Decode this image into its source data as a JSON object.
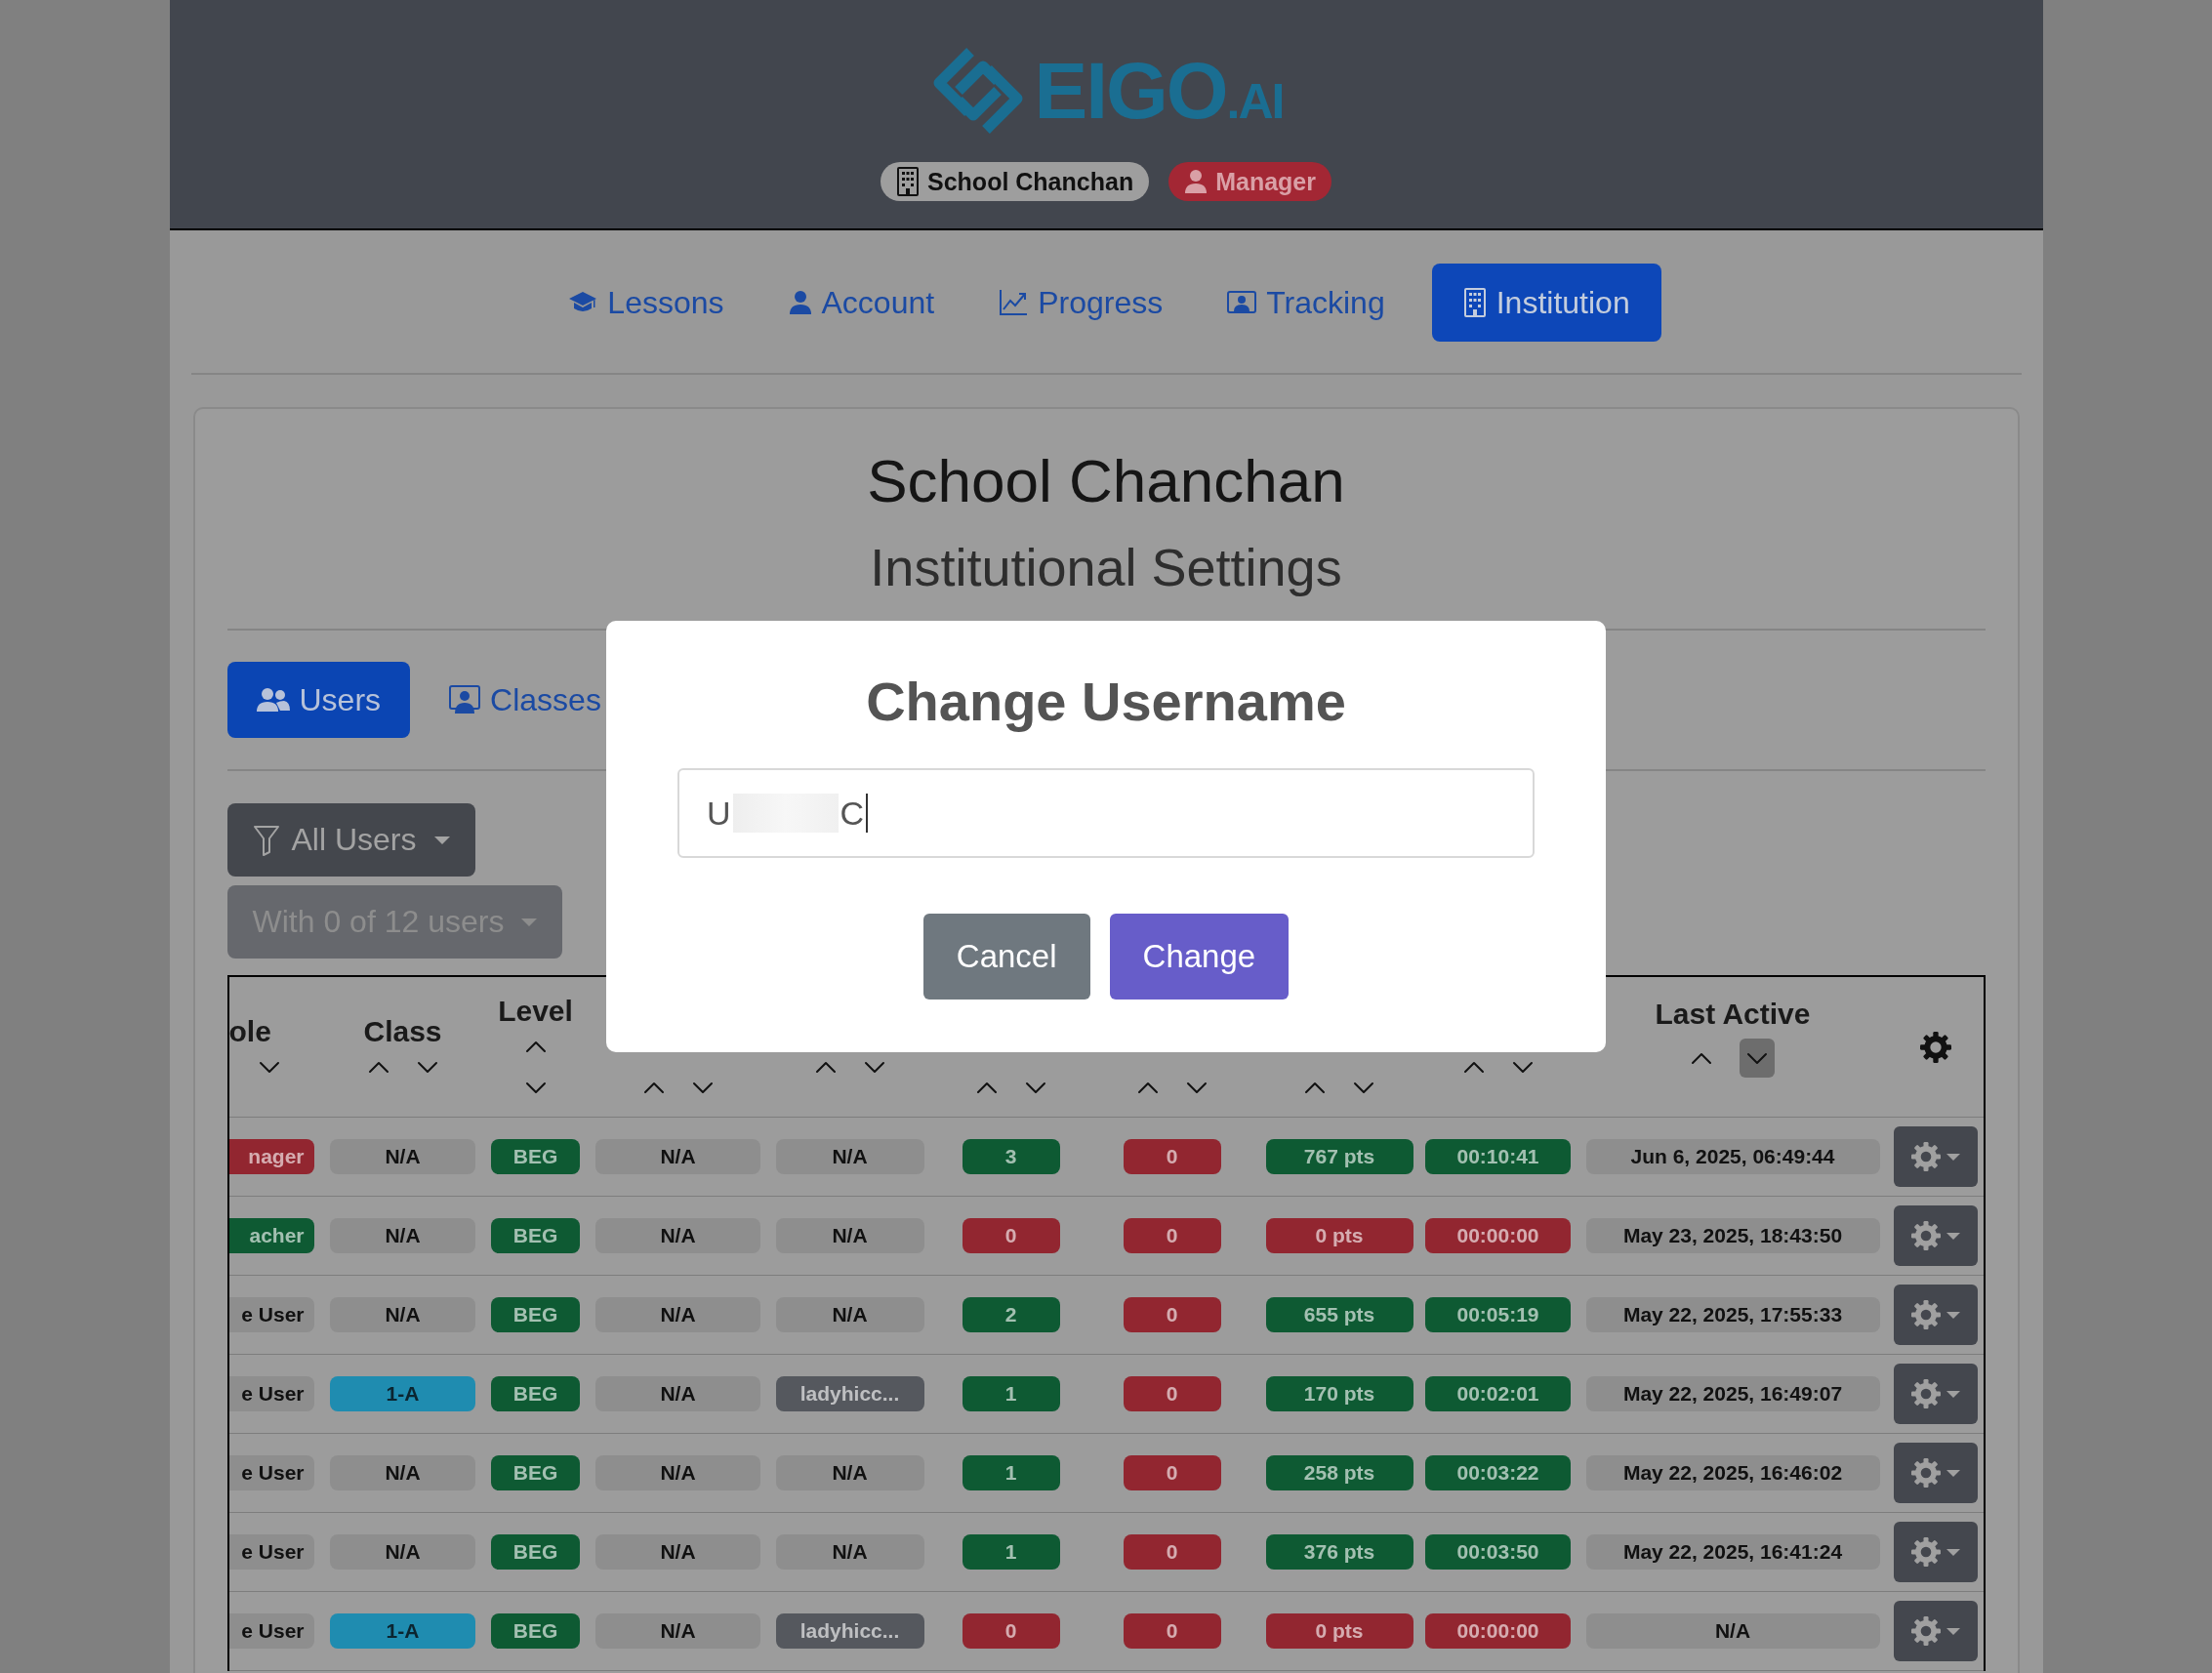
{
  "header": {
    "logo": {
      "text": "EIGO",
      "suffix": ".AI"
    },
    "badges": [
      {
        "kind": "institution",
        "label": "School Chanchan"
      },
      {
        "kind": "role",
        "label": "Manager"
      }
    ]
  },
  "nav": [
    {
      "kind": "cap",
      "label": "Lessons",
      "selected": false
    },
    {
      "kind": "person",
      "label": "Account",
      "selected": false
    },
    {
      "kind": "chart",
      "label": "Progress",
      "selected": false
    },
    {
      "kind": "frame",
      "label": "Tracking",
      "selected": false
    },
    {
      "kind": "building",
      "label": "Institution",
      "selected": true
    }
  ],
  "institution": {
    "title": "School Chanchan",
    "subtitle": "Institutional Settings"
  },
  "tabs": [
    {
      "kind": "users",
      "label": "Users",
      "selected": true
    },
    {
      "kind": "classes",
      "label": "Classes",
      "selected": false
    }
  ],
  "filters": [
    {
      "kind": "filter",
      "label": "All Users",
      "disabled": false
    },
    {
      "kind": "plain",
      "label": "With 0 of 12 users",
      "disabled": true
    }
  ],
  "table": {
    "columns": [
      {
        "kind": "row",
        "label": "ole",
        "sorted_desc": false
      },
      {
        "kind": "row",
        "label": "Class",
        "up_arrow": true,
        "sorted_desc": false
      },
      {
        "kind": "stacked",
        "label": "Level",
        "up_arrow": true,
        "sorted_desc": false
      },
      {
        "kind": "low",
        "up_arrow": true,
        "sorted_desc": false
      },
      {
        "kind": "row",
        "up_arrow": true,
        "sorted_desc": false
      },
      {
        "kind": "low",
        "up_arrow": true,
        "sorted_desc": false
      },
      {
        "kind": "low",
        "up_arrow": true,
        "sorted_desc": false
      },
      {
        "kind": "low",
        "up_arrow": true,
        "sorted_desc": false
      },
      {
        "kind": "row",
        "up_arrow": true,
        "sorted_desc": false
      },
      {
        "kind": "row",
        "label": "Last Active",
        "up_arrow": true,
        "sorted_desc": true
      },
      {
        "kind": "settings"
      }
    ],
    "rows": [
      {
        "cells": [
          {
            "text": "nager",
            "color": "#922630"
          },
          {
            "text": "N/A",
            "color": "#8e8e8e"
          },
          {
            "text": "BEG",
            "color": "#0e5a33"
          },
          {
            "text": "N/A",
            "color": "#8e8e8e"
          },
          {
            "text": "N/A",
            "color": "#8e8e8e"
          },
          {
            "text": "3",
            "color": "#0e5a33"
          },
          {
            "text": "0",
            "color": "#922630"
          },
          {
            "text": "767 pts",
            "color": "#0e5a33"
          },
          {
            "text": "00:10:41",
            "color": "#0e5a33"
          },
          {
            "text": "Jun 6, 2025, 06:49:44",
            "color": "#8e8e8e"
          }
        ]
      },
      {
        "cells": [
          {
            "text": "acher",
            "color": "#0e5a33"
          },
          {
            "text": "N/A",
            "color": "#8e8e8e"
          },
          {
            "text": "BEG",
            "color": "#0e5a33"
          },
          {
            "text": "N/A",
            "color": "#8e8e8e"
          },
          {
            "text": "N/A",
            "color": "#8e8e8e"
          },
          {
            "text": "0",
            "color": "#922630"
          },
          {
            "text": "0",
            "color": "#922630"
          },
          {
            "text": "0 pts",
            "color": "#922630"
          },
          {
            "text": "00:00:00",
            "color": "#922630"
          },
          {
            "text": "May 23, 2025, 18:43:50",
            "color": "#8e8e8e"
          }
        ]
      },
      {
        "cells": [
          {
            "text": "e User",
            "color": "#8e8e8e"
          },
          {
            "text": "N/A",
            "color": "#8e8e8e"
          },
          {
            "text": "BEG",
            "color": "#0e5a33"
          },
          {
            "text": "N/A",
            "color": "#8e8e8e"
          },
          {
            "text": "N/A",
            "color": "#8e8e8e"
          },
          {
            "text": "2",
            "color": "#0e5a33"
          },
          {
            "text": "0",
            "color": "#922630"
          },
          {
            "text": "655 pts",
            "color": "#0e5a33"
          },
          {
            "text": "00:05:19",
            "color": "#0e5a33"
          },
          {
            "text": "May 22, 2025, 17:55:33",
            "color": "#8e8e8e"
          }
        ]
      },
      {
        "cells": [
          {
            "text": "e User",
            "color": "#8e8e8e"
          },
          {
            "text": "1-A",
            "color": "#1f8cb0"
          },
          {
            "text": "BEG",
            "color": "#0e5a33"
          },
          {
            "text": "N/A",
            "color": "#8e8e8e"
          },
          {
            "text": "ladyhicc...",
            "color": "#55585e"
          },
          {
            "text": "1",
            "color": "#0e5a33"
          },
          {
            "text": "0",
            "color": "#922630"
          },
          {
            "text": "170 pts",
            "color": "#0e5a33"
          },
          {
            "text": "00:02:01",
            "color": "#0e5a33"
          },
          {
            "text": "May 22, 2025, 16:49:07",
            "color": "#8e8e8e"
          }
        ]
      },
      {
        "cells": [
          {
            "text": "e User",
            "color": "#8e8e8e"
          },
          {
            "text": "N/A",
            "color": "#8e8e8e"
          },
          {
            "text": "BEG",
            "color": "#0e5a33"
          },
          {
            "text": "N/A",
            "color": "#8e8e8e"
          },
          {
            "text": "N/A",
            "color": "#8e8e8e"
          },
          {
            "text": "1",
            "color": "#0e5a33"
          },
          {
            "text": "0",
            "color": "#922630"
          },
          {
            "text": "258 pts",
            "color": "#0e5a33"
          },
          {
            "text": "00:03:22",
            "color": "#0e5a33"
          },
          {
            "text": "May 22, 2025, 16:46:02",
            "color": "#8e8e8e"
          }
        ]
      },
      {
        "cells": [
          {
            "text": "e User",
            "color": "#8e8e8e"
          },
          {
            "text": "N/A",
            "color": "#8e8e8e"
          },
          {
            "text": "BEG",
            "color": "#0e5a33"
          },
          {
            "text": "N/A",
            "color": "#8e8e8e"
          },
          {
            "text": "N/A",
            "color": "#8e8e8e"
          },
          {
            "text": "1",
            "color": "#0e5a33"
          },
          {
            "text": "0",
            "color": "#922630"
          },
          {
            "text": "376 pts",
            "color": "#0e5a33"
          },
          {
            "text": "00:03:50",
            "color": "#0e5a33"
          },
          {
            "text": "May 22, 2025, 16:41:24",
            "color": "#8e8e8e"
          }
        ]
      },
      {
        "cells": [
          {
            "text": "e User",
            "color": "#8e8e8e"
          },
          {
            "text": "1-A",
            "color": "#1f8cb0"
          },
          {
            "text": "BEG",
            "color": "#0e5a33"
          },
          {
            "text": "N/A",
            "color": "#8e8e8e"
          },
          {
            "text": "ladyhicc...",
            "color": "#55585e"
          },
          {
            "text": "0",
            "color": "#922630"
          },
          {
            "text": "0",
            "color": "#922630"
          },
          {
            "text": "0 pts",
            "color": "#922630"
          },
          {
            "text": "00:00:00",
            "color": "#922630"
          },
          {
            "text": "N/A",
            "color": "#8e8e8e"
          }
        ]
      }
    ]
  },
  "modal": {
    "title": "Change Username",
    "input": {
      "value_start": "U",
      "value_end": "C"
    },
    "buttons": [
      {
        "kind": "secondary",
        "label": "Cancel"
      },
      {
        "kind": "primary",
        "label": "Change"
      }
    ]
  }
}
